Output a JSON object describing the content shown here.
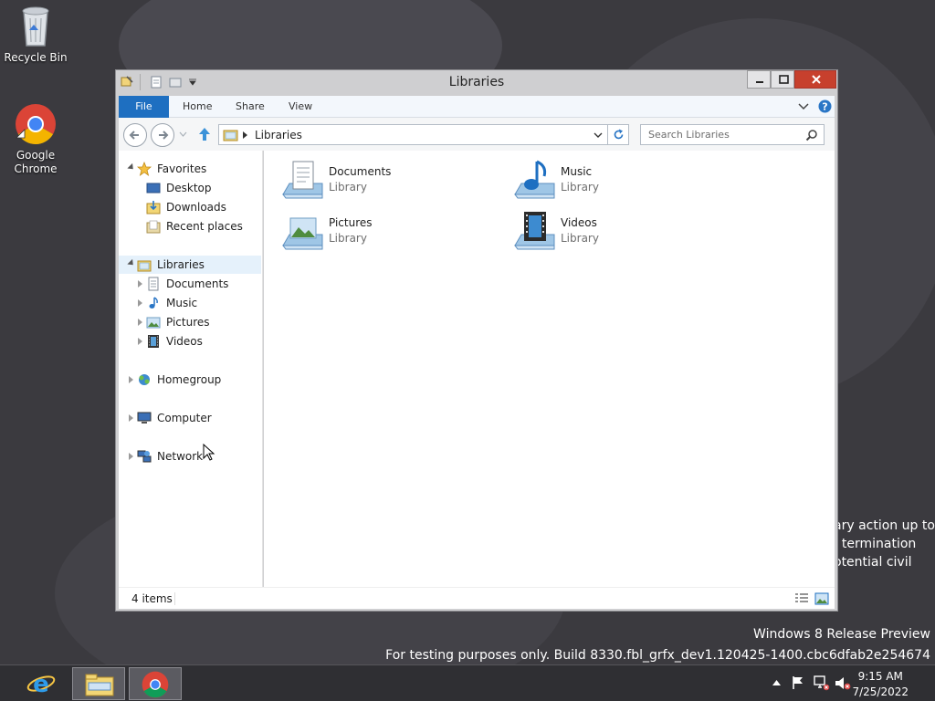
{
  "desktop": {
    "icons": [
      {
        "label": "Recycle Bin",
        "icon": "recycle-bin-icon"
      },
      {
        "label": "Google Chrome",
        "icon": "chrome-icon"
      }
    ],
    "background_text": [
      "ary action up to",
      ", termination",
      "otential civil"
    ],
    "watermark": {
      "line1": "Windows 8 Release Preview",
      "line2": "For testing purposes only. Build 8330.fbl_grfx_dev1.120425-1400.cbc6dfab2e254674"
    }
  },
  "window": {
    "title": "Libraries",
    "controls": {
      "minimize": "minimize-icon",
      "maximize": "maximize-icon",
      "close": "close-icon"
    },
    "ribbon": {
      "tabs": [
        "File",
        "Home",
        "Share",
        "View"
      ],
      "active_tab": "File",
      "accent_color": "#1e6fc1"
    },
    "address": {
      "path": "Libraries"
    },
    "search": {
      "placeholder": "Search Libraries"
    },
    "nav_pane": {
      "favorites": {
        "label": "Favorites",
        "items": [
          "Desktop",
          "Downloads",
          "Recent places"
        ]
      },
      "libraries": {
        "label": "Libraries",
        "items": [
          "Documents",
          "Music",
          "Pictures",
          "Videos"
        ]
      },
      "homegroup": "Homegroup",
      "computer": "Computer",
      "network": "Network"
    },
    "content": {
      "items": [
        {
          "name": "Documents",
          "type": "Library",
          "icon": "documents-library-icon"
        },
        {
          "name": "Music",
          "type": "Library",
          "icon": "music-library-icon"
        },
        {
          "name": "Pictures",
          "type": "Library",
          "icon": "pictures-library-icon"
        },
        {
          "name": "Videos",
          "type": "Library",
          "icon": "videos-library-icon"
        }
      ]
    },
    "status": {
      "item_count": "4 items"
    }
  },
  "taskbar": {
    "buttons": [
      {
        "name": "Internet Explorer",
        "icon": "ie-icon"
      },
      {
        "name": "File Explorer",
        "icon": "file-explorer-icon"
      },
      {
        "name": "Google Chrome",
        "icon": "chrome-icon"
      }
    ],
    "clock": {
      "time": "9:15 AM",
      "date": "7/25/2022"
    }
  }
}
